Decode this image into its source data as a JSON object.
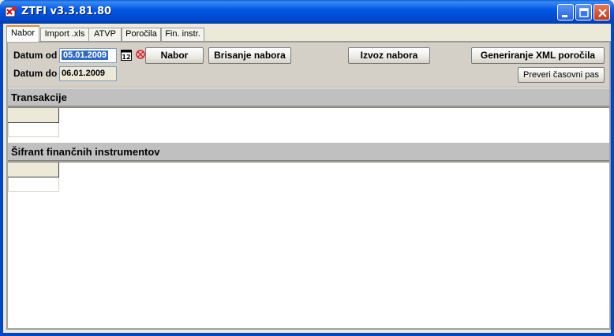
{
  "window": {
    "title": "ZTFI v3.3.81.80"
  },
  "tabs": [
    {
      "label": "Nabor",
      "active": true
    },
    {
      "label": "Import .xls",
      "active": false
    },
    {
      "label": "ATVP",
      "active": false
    },
    {
      "label": "Poročila",
      "active": false
    },
    {
      "label": "Fin. instr.",
      "active": false
    }
  ],
  "filters": {
    "date_from_label": "Datum od",
    "date_from_value": "05.01.2009",
    "date_to_label": "Datum do",
    "date_to_value": "06.01.2009",
    "calendar_icon_text": "12"
  },
  "actions": {
    "nabor_label": "Nabor",
    "brisanje_label": "Brisanje nabora",
    "izvoz_label": "Izvoz nabora",
    "generiranje_label": "Generiranje XML poročila",
    "preveri_label": "Preveri časovni pas"
  },
  "sections": {
    "transakcije_title": "Transakcije",
    "sifrant_title": "Šifrant finančnih instrumentov"
  },
  "colors": {
    "titlebar": "#0058E6",
    "panel": "#D4D0C8",
    "selection": "#316AC5",
    "active_tab_accent": "#E68B2C"
  }
}
